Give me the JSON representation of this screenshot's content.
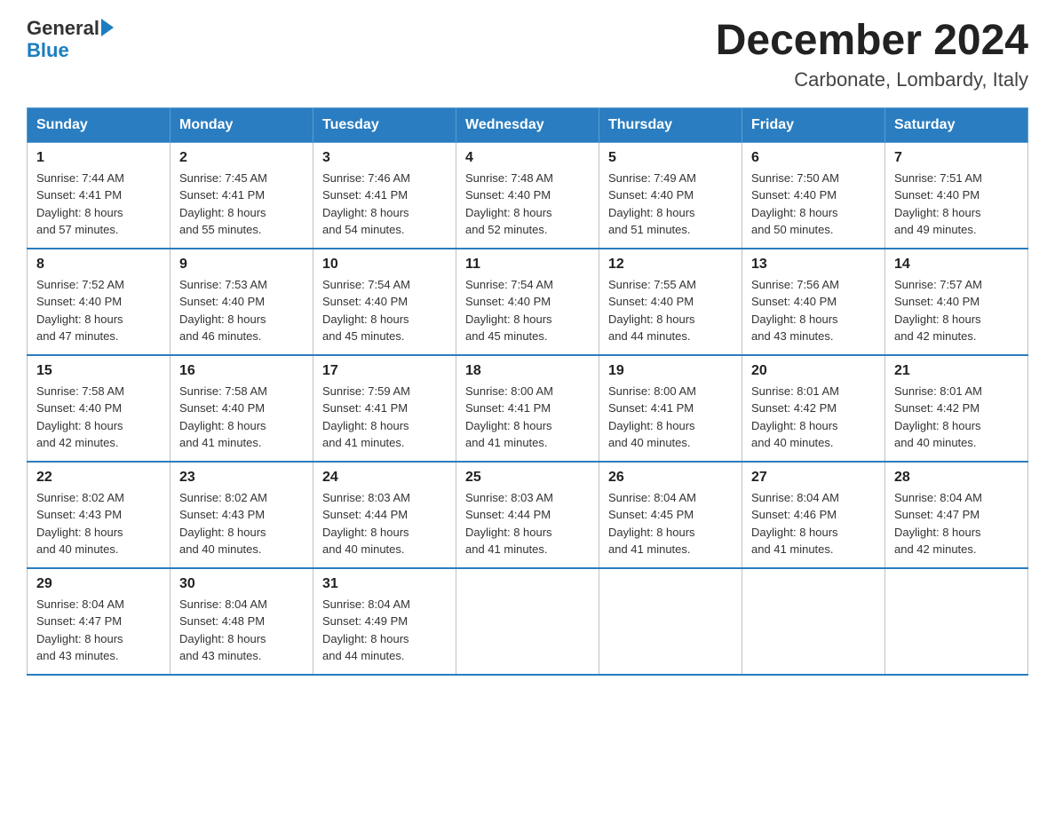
{
  "logo": {
    "part1": "General",
    "part2": "Blue"
  },
  "header": {
    "month_year": "December 2024",
    "location": "Carbonate, Lombardy, Italy"
  },
  "weekdays": [
    "Sunday",
    "Monday",
    "Tuesday",
    "Wednesday",
    "Thursday",
    "Friday",
    "Saturday"
  ],
  "weeks": [
    [
      {
        "day": "1",
        "sunrise": "7:44 AM",
        "sunset": "4:41 PM",
        "daylight": "8 hours and 57 minutes."
      },
      {
        "day": "2",
        "sunrise": "7:45 AM",
        "sunset": "4:41 PM",
        "daylight": "8 hours and 55 minutes."
      },
      {
        "day": "3",
        "sunrise": "7:46 AM",
        "sunset": "4:41 PM",
        "daylight": "8 hours and 54 minutes."
      },
      {
        "day": "4",
        "sunrise": "7:48 AM",
        "sunset": "4:40 PM",
        "daylight": "8 hours and 52 minutes."
      },
      {
        "day": "5",
        "sunrise": "7:49 AM",
        "sunset": "4:40 PM",
        "daylight": "8 hours and 51 minutes."
      },
      {
        "day": "6",
        "sunrise": "7:50 AM",
        "sunset": "4:40 PM",
        "daylight": "8 hours and 50 minutes."
      },
      {
        "day": "7",
        "sunrise": "7:51 AM",
        "sunset": "4:40 PM",
        "daylight": "8 hours and 49 minutes."
      }
    ],
    [
      {
        "day": "8",
        "sunrise": "7:52 AM",
        "sunset": "4:40 PM",
        "daylight": "8 hours and 47 minutes."
      },
      {
        "day": "9",
        "sunrise": "7:53 AM",
        "sunset": "4:40 PM",
        "daylight": "8 hours and 46 minutes."
      },
      {
        "day": "10",
        "sunrise": "7:54 AM",
        "sunset": "4:40 PM",
        "daylight": "8 hours and 45 minutes."
      },
      {
        "day": "11",
        "sunrise": "7:54 AM",
        "sunset": "4:40 PM",
        "daylight": "8 hours and 45 minutes."
      },
      {
        "day": "12",
        "sunrise": "7:55 AM",
        "sunset": "4:40 PM",
        "daylight": "8 hours and 44 minutes."
      },
      {
        "day": "13",
        "sunrise": "7:56 AM",
        "sunset": "4:40 PM",
        "daylight": "8 hours and 43 minutes."
      },
      {
        "day": "14",
        "sunrise": "7:57 AM",
        "sunset": "4:40 PM",
        "daylight": "8 hours and 42 minutes."
      }
    ],
    [
      {
        "day": "15",
        "sunrise": "7:58 AM",
        "sunset": "4:40 PM",
        "daylight": "8 hours and 42 minutes."
      },
      {
        "day": "16",
        "sunrise": "7:58 AM",
        "sunset": "4:40 PM",
        "daylight": "8 hours and 41 minutes."
      },
      {
        "day": "17",
        "sunrise": "7:59 AM",
        "sunset": "4:41 PM",
        "daylight": "8 hours and 41 minutes."
      },
      {
        "day": "18",
        "sunrise": "8:00 AM",
        "sunset": "4:41 PM",
        "daylight": "8 hours and 41 minutes."
      },
      {
        "day": "19",
        "sunrise": "8:00 AM",
        "sunset": "4:41 PM",
        "daylight": "8 hours and 40 minutes."
      },
      {
        "day": "20",
        "sunrise": "8:01 AM",
        "sunset": "4:42 PM",
        "daylight": "8 hours and 40 minutes."
      },
      {
        "day": "21",
        "sunrise": "8:01 AM",
        "sunset": "4:42 PM",
        "daylight": "8 hours and 40 minutes."
      }
    ],
    [
      {
        "day": "22",
        "sunrise": "8:02 AM",
        "sunset": "4:43 PM",
        "daylight": "8 hours and 40 minutes."
      },
      {
        "day": "23",
        "sunrise": "8:02 AM",
        "sunset": "4:43 PM",
        "daylight": "8 hours and 40 minutes."
      },
      {
        "day": "24",
        "sunrise": "8:03 AM",
        "sunset": "4:44 PM",
        "daylight": "8 hours and 40 minutes."
      },
      {
        "day": "25",
        "sunrise": "8:03 AM",
        "sunset": "4:44 PM",
        "daylight": "8 hours and 41 minutes."
      },
      {
        "day": "26",
        "sunrise": "8:04 AM",
        "sunset": "4:45 PM",
        "daylight": "8 hours and 41 minutes."
      },
      {
        "day": "27",
        "sunrise": "8:04 AM",
        "sunset": "4:46 PM",
        "daylight": "8 hours and 41 minutes."
      },
      {
        "day": "28",
        "sunrise": "8:04 AM",
        "sunset": "4:47 PM",
        "daylight": "8 hours and 42 minutes."
      }
    ],
    [
      {
        "day": "29",
        "sunrise": "8:04 AM",
        "sunset": "4:47 PM",
        "daylight": "8 hours and 43 minutes."
      },
      {
        "day": "30",
        "sunrise": "8:04 AM",
        "sunset": "4:48 PM",
        "daylight": "8 hours and 43 minutes."
      },
      {
        "day": "31",
        "sunrise": "8:04 AM",
        "sunset": "4:49 PM",
        "daylight": "8 hours and 44 minutes."
      },
      null,
      null,
      null,
      null
    ]
  ],
  "labels": {
    "sunrise": "Sunrise:",
    "sunset": "Sunset:",
    "daylight": "Daylight:"
  }
}
